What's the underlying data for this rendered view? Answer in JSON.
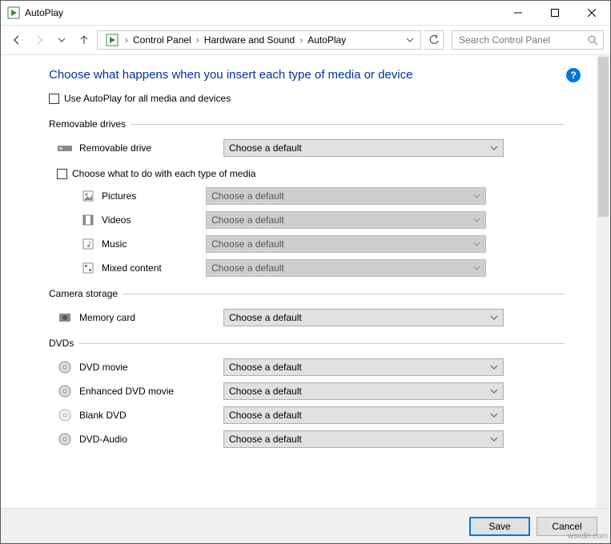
{
  "window": {
    "title": "AutoPlay"
  },
  "breadcrumb": {
    "items": [
      "Control Panel",
      "Hardware and Sound",
      "AutoPlay"
    ]
  },
  "search": {
    "placeholder": "Search Control Panel"
  },
  "heading": "Choose what happens when you insert each type of media or device",
  "use_autoplay_label": "Use AutoPlay for all media and devices",
  "choose_media_label": "Choose what to do with each type of media",
  "default_option": "Choose a default",
  "groups": {
    "removable": {
      "legend": "Removable drives",
      "item": "Removable drive",
      "media": {
        "pictures": "Pictures",
        "videos": "Videos",
        "music": "Music",
        "mixed": "Mixed content"
      }
    },
    "camera": {
      "legend": "Camera storage",
      "item": "Memory card"
    },
    "dvds": {
      "legend": "DVDs",
      "items": {
        "movie": "DVD movie",
        "enhanced": "Enhanced DVD movie",
        "blank": "Blank DVD",
        "audio": "DVD-Audio"
      }
    }
  },
  "footer": {
    "save": "Save",
    "cancel": "Cancel"
  },
  "watermark": "wsxdn.com"
}
